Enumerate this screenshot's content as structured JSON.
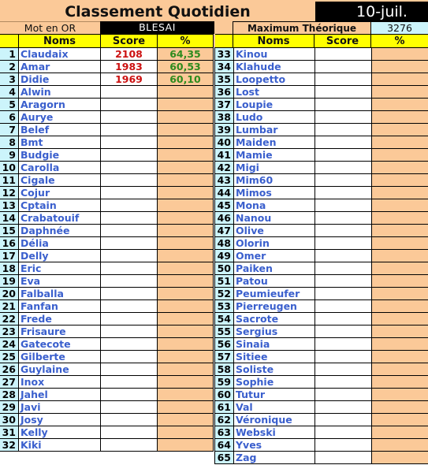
{
  "title": "Classement Quotidien",
  "date": "10-juil.",
  "mot_en_or": {
    "label": "Mot en OR",
    "value": "BLESAI"
  },
  "maximum": {
    "label": "Maximum Théorique",
    "value": "3276"
  },
  "columns": {
    "noms": "Noms",
    "score": "Score",
    "pct": "%"
  },
  "colors": {
    "header": "#ffff00",
    "peach": "#fbc998",
    "num_bg": "#ccf4fb",
    "name": "#3a5fcd",
    "score": "#cc1111",
    "pct": "#2e8b1e"
  },
  "left_rows": [
    {
      "num": "1",
      "name": "Claudaix",
      "score": "2108",
      "pct": "64,35"
    },
    {
      "num": "2",
      "name": "Amar",
      "score": "1983",
      "pct": "60,53"
    },
    {
      "num": "3",
      "name": "Didie",
      "score": "1969",
      "pct": "60,10"
    },
    {
      "num": "4",
      "name": "Alwin",
      "score": "",
      "pct": ""
    },
    {
      "num": "5",
      "name": "Aragorn",
      "score": "",
      "pct": ""
    },
    {
      "num": "6",
      "name": "Aurye",
      "score": "",
      "pct": ""
    },
    {
      "num": "7",
      "name": "Belef",
      "score": "",
      "pct": ""
    },
    {
      "num": "8",
      "name": "Bmt",
      "score": "",
      "pct": ""
    },
    {
      "num": "9",
      "name": "Budgie",
      "score": "",
      "pct": ""
    },
    {
      "num": "10",
      "name": "Carolla",
      "score": "",
      "pct": ""
    },
    {
      "num": "11",
      "name": "Cigale",
      "score": "",
      "pct": ""
    },
    {
      "num": "12",
      "name": "Cojur",
      "score": "",
      "pct": ""
    },
    {
      "num": "13",
      "name": "Cptain",
      "score": "",
      "pct": ""
    },
    {
      "num": "14",
      "name": "Crabatouif",
      "score": "",
      "pct": ""
    },
    {
      "num": "15",
      "name": "Daphnée",
      "score": "",
      "pct": ""
    },
    {
      "num": "16",
      "name": "Délia",
      "score": "",
      "pct": ""
    },
    {
      "num": "17",
      "name": "Delly",
      "score": "",
      "pct": ""
    },
    {
      "num": "18",
      "name": "Eric",
      "score": "",
      "pct": ""
    },
    {
      "num": "19",
      "name": "Eva",
      "score": "",
      "pct": ""
    },
    {
      "num": "20",
      "name": "Falballa",
      "score": "",
      "pct": ""
    },
    {
      "num": "21",
      "name": "Fanfan",
      "score": "",
      "pct": ""
    },
    {
      "num": "22",
      "name": "Frede",
      "score": "",
      "pct": ""
    },
    {
      "num": "23",
      "name": "Frisaure",
      "score": "",
      "pct": ""
    },
    {
      "num": "24",
      "name": "Gatecote",
      "score": "",
      "pct": ""
    },
    {
      "num": "25",
      "name": "Gilberte",
      "score": "",
      "pct": ""
    },
    {
      "num": "26",
      "name": "Guylaine",
      "score": "",
      "pct": ""
    },
    {
      "num": "27",
      "name": "Inox",
      "score": "",
      "pct": ""
    },
    {
      "num": "28",
      "name": "Jahel",
      "score": "",
      "pct": ""
    },
    {
      "num": "29",
      "name": "Javi",
      "score": "",
      "pct": ""
    },
    {
      "num": "30",
      "name": "Josy",
      "score": "",
      "pct": ""
    },
    {
      "num": "31",
      "name": "Kelly",
      "score": "",
      "pct": ""
    },
    {
      "num": "32",
      "name": "Kiki",
      "score": "",
      "pct": ""
    }
  ],
  "right_rows": [
    {
      "num": "33",
      "name": "Kinou",
      "score": "",
      "pct": ""
    },
    {
      "num": "34",
      "name": "Klahude",
      "score": "",
      "pct": ""
    },
    {
      "num": "35",
      "name": "Loopetto",
      "score": "",
      "pct": ""
    },
    {
      "num": "36",
      "name": "Lost",
      "score": "",
      "pct": ""
    },
    {
      "num": "37",
      "name": "Loupie",
      "score": "",
      "pct": ""
    },
    {
      "num": "38",
      "name": "Ludo",
      "score": "",
      "pct": ""
    },
    {
      "num": "39",
      "name": "Lumbar",
      "score": "",
      "pct": ""
    },
    {
      "num": "40",
      "name": "Maiden",
      "score": "",
      "pct": ""
    },
    {
      "num": "41",
      "name": "Mamie",
      "score": "",
      "pct": ""
    },
    {
      "num": "42",
      "name": "Migi",
      "score": "",
      "pct": ""
    },
    {
      "num": "43",
      "name": "Mim60",
      "score": "",
      "pct": ""
    },
    {
      "num": "44",
      "name": "Mimos",
      "score": "",
      "pct": ""
    },
    {
      "num": "45",
      "name": "Mona",
      "score": "",
      "pct": ""
    },
    {
      "num": "46",
      "name": "Nanou",
      "score": "",
      "pct": ""
    },
    {
      "num": "47",
      "name": "Olive",
      "score": "",
      "pct": ""
    },
    {
      "num": "48",
      "name": "Olorin",
      "score": "",
      "pct": ""
    },
    {
      "num": "49",
      "name": "Omer",
      "score": "",
      "pct": ""
    },
    {
      "num": "50",
      "name": "Paiken",
      "score": "",
      "pct": ""
    },
    {
      "num": "51",
      "name": "Patou",
      "score": "",
      "pct": ""
    },
    {
      "num": "52",
      "name": "Peumieufer",
      "score": "",
      "pct": ""
    },
    {
      "num": "53",
      "name": "Pierreugen",
      "score": "",
      "pct": ""
    },
    {
      "num": "54",
      "name": "Sacrote",
      "score": "",
      "pct": ""
    },
    {
      "num": "55",
      "name": "Sergius",
      "score": "",
      "pct": ""
    },
    {
      "num": "56",
      "name": "Sinaia",
      "score": "",
      "pct": ""
    },
    {
      "num": "57",
      "name": "Sitiee",
      "score": "",
      "pct": ""
    },
    {
      "num": "58",
      "name": "Soliste",
      "score": "",
      "pct": ""
    },
    {
      "num": "59",
      "name": "Sophie",
      "score": "",
      "pct": ""
    },
    {
      "num": "60",
      "name": "Tutur",
      "score": "",
      "pct": ""
    },
    {
      "num": "61",
      "name": "Val",
      "score": "",
      "pct": ""
    },
    {
      "num": "62",
      "name": "Véronique",
      "score": "",
      "pct": ""
    },
    {
      "num": "63",
      "name": "Webski",
      "score": "",
      "pct": ""
    },
    {
      "num": "64",
      "name": "Yves",
      "score": "",
      "pct": ""
    },
    {
      "num": "65",
      "name": "Zag",
      "score": "",
      "pct": ""
    }
  ]
}
